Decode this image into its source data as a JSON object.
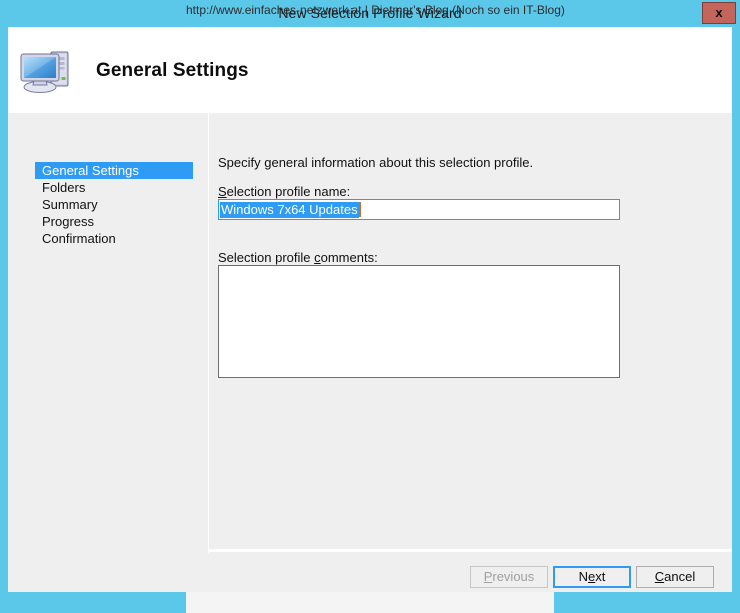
{
  "window": {
    "title": "New Selection Profile Wizard",
    "close_label": "x",
    "frame_color": "#5bc8ea",
    "accent_color": "#2e9bf5",
    "close_button_color": "#c4655c"
  },
  "header": {
    "title": "General Settings",
    "icon": "computer-icon"
  },
  "sidebar": {
    "items": [
      {
        "label": "General Settings",
        "selected": true
      },
      {
        "label": "Folders",
        "selected": false
      },
      {
        "label": "Summary",
        "selected": false
      },
      {
        "label": "Progress",
        "selected": false
      },
      {
        "label": "Confirmation",
        "selected": false
      }
    ]
  },
  "main": {
    "intro": "Specify general information about this selection profile.",
    "name_label_pre": "",
    "name_label_accel": "S",
    "name_label_post": "election profile name:",
    "name_value": "Windows 7x64 Updates",
    "comments_label_pre": "Selection profile ",
    "comments_label_accel": "c",
    "comments_label_post": "omments:",
    "comments_value": "",
    "comments_placeholder": ""
  },
  "buttons": {
    "previous_pre": "",
    "previous_accel": "P",
    "previous_post": "revious",
    "previous_enabled": false,
    "next_pre": "N",
    "next_accel": "e",
    "next_post": "xt",
    "next_default": true,
    "cancel_pre": "",
    "cancel_accel": "C",
    "cancel_post": "ancel"
  },
  "footer": {
    "watermark": "http://www.einfaches-netzwerk.at | Dietmar's Blog (Noch so ein IT-Blog)"
  }
}
